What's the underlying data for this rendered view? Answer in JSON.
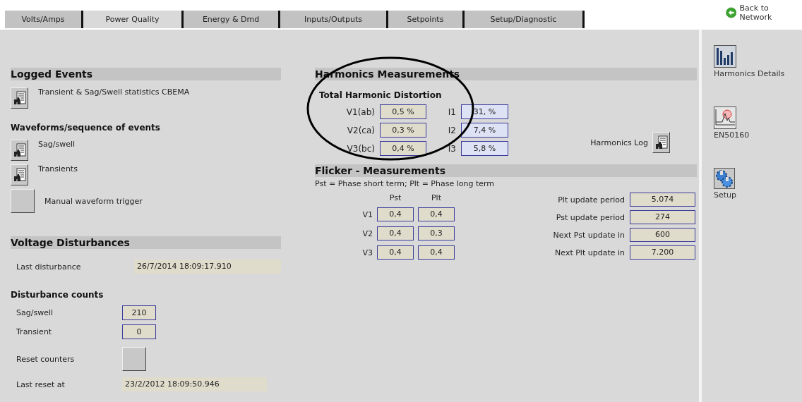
{
  "tabs": [
    {
      "label": "Volts/Amps",
      "selected": false
    },
    {
      "label": "Power Quality",
      "selected": true
    },
    {
      "label": "Energy & Dmd",
      "selected": false
    },
    {
      "label": "Inputs/Outputs",
      "selected": false
    },
    {
      "label": "Setpoints",
      "selected": false
    },
    {
      "label": "Setup/Diagnostic",
      "selected": false
    }
  ],
  "back_link": "Back to Network",
  "logged_events": {
    "title": "Logged Events",
    "items": [
      {
        "kind": "report",
        "label": "Transient & Sag/Swell statistics CBEMA"
      }
    ]
  },
  "waveforms": {
    "title": "Waveforms/sequence of events",
    "items": [
      {
        "kind": "report",
        "label": "Sag/swell"
      },
      {
        "kind": "report",
        "label": "Transients"
      },
      {
        "kind": "blank",
        "label": "Manual waveform trigger"
      }
    ]
  },
  "voltage_disturbances": {
    "title": "Voltage Disturbances",
    "last_disturbance": {
      "label": "Last disturbance",
      "value": "26/7/2014 18:09:17.910"
    },
    "counts_title": "Disturbance counts",
    "counts": [
      {
        "label": "Sag/swell",
        "value": "210"
      },
      {
        "label": "Transient",
        "value": "0"
      }
    ],
    "reset_label": "Reset counters",
    "last_reset": {
      "label": "Last reset at",
      "value": "23/2/2012 18:09:50.946"
    }
  },
  "harmonics": {
    "title": "Harmonics Measurements",
    "subtitle": "Total Harmonic Distortion",
    "voltage": [
      {
        "label": "V1(ab)",
        "value": "0,5 %"
      },
      {
        "label": "V2(ca)",
        "value": "0,3 %"
      },
      {
        "label": "V3(bc)",
        "value": "0,4 %"
      }
    ],
    "current": [
      {
        "label": "I1",
        "value": "31, %"
      },
      {
        "label": "I2",
        "value": "7,4 %"
      },
      {
        "label": "I3",
        "value": "5,8 %"
      }
    ],
    "log_label": "Harmonics Log"
  },
  "flicker": {
    "title": "Flicker - Measurements",
    "note": "Pst = Phase short term; Plt = Phase long term",
    "columns": [
      "Pst",
      "Plt"
    ],
    "rows": [
      {
        "label": "V1",
        "values": [
          "0,4",
          "0,4"
        ]
      },
      {
        "label": "V2",
        "values": [
          "0,4",
          "0,3"
        ]
      },
      {
        "label": "V3",
        "values": [
          "0,4",
          "0,4"
        ]
      }
    ],
    "periods": [
      {
        "label": "Plt update period",
        "value": "5.074"
      },
      {
        "label": "Pst update period",
        "value": "274"
      },
      {
        "label": "Next Pst update in",
        "value": "600"
      },
      {
        "label": "Next Plt update in",
        "value": "7.200"
      }
    ]
  },
  "sidebar": [
    {
      "kind": "harmonics",
      "label": "Harmonics Details"
    },
    {
      "kind": "en50160",
      "label": "EN50160"
    },
    {
      "kind": "setup",
      "label": "Setup"
    }
  ]
}
